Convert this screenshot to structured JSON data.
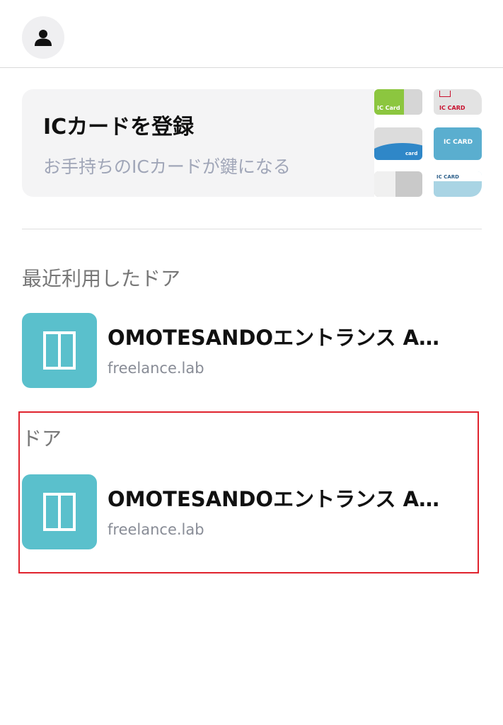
{
  "header": {
    "avatar_icon": "person-icon"
  },
  "ic_banner": {
    "title": "ICカードを登録",
    "subtitle": "お手持ちのICカードが鍵になる",
    "card_labels": [
      "IC Card",
      "IC CARD",
      "card",
      "IC CARD",
      "IC CARD"
    ]
  },
  "recent": {
    "section_title": "最近利用したドア",
    "items": [
      {
        "name": "OMOTESANDOエントランス A…",
        "org": "freelance.lab",
        "icon": "door-icon"
      }
    ]
  },
  "doors": {
    "section_title": "ドア",
    "items": [
      {
        "name": "OMOTESANDOエントランス A…",
        "org": "freelance.lab",
        "icon": "door-icon"
      }
    ]
  },
  "colors": {
    "accent": "#5ac0cc",
    "highlight": "#e0232e",
    "banner_bg": "#f4f4f5",
    "subtitle": "#a0a6b8"
  }
}
